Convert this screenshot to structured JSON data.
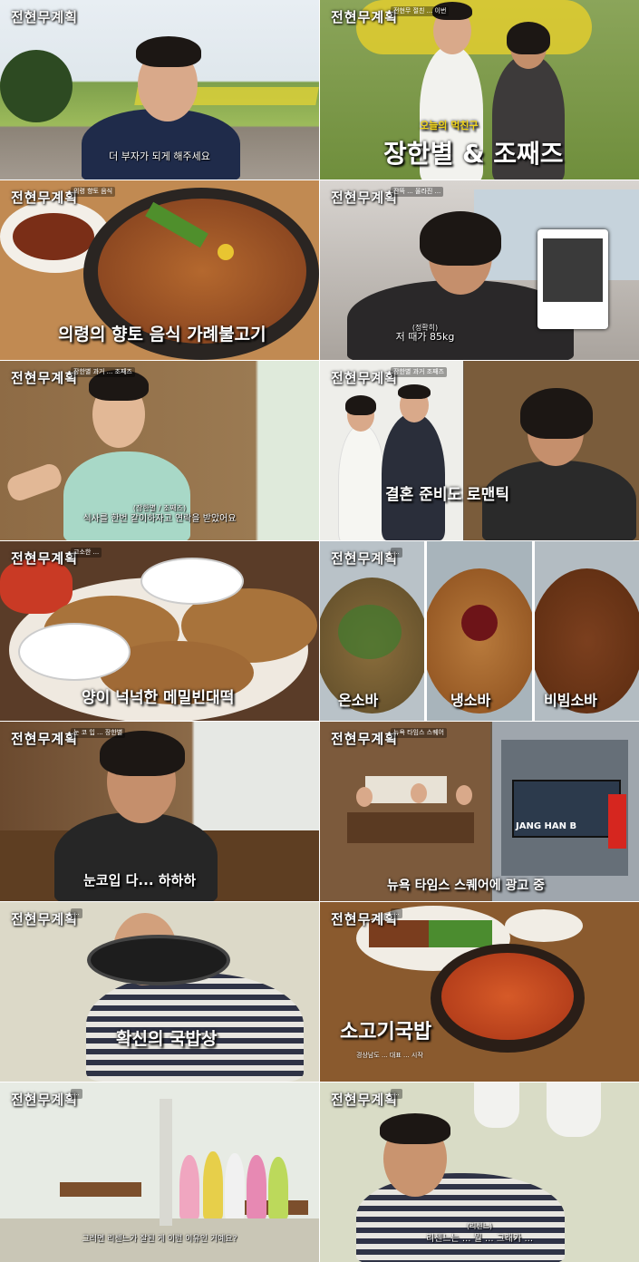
{
  "show_logo": "전현무계획",
  "panels": [
    {
      "tag": "",
      "subtitle": "더 부자가 되게 해주세요"
    },
    {
      "tag": "전현무 절친 ... 이번",
      "caption_small": "오늘의 먹친구",
      "caption_big": "장한별 & 조째즈"
    },
    {
      "tag": "의령 향토 음식",
      "caption_big": "의령의 향토 음식 가례불고기"
    },
    {
      "tag": "잔뜩 ... 올라진 ...",
      "subtitle_small": "(정확히)",
      "subtitle": "저 때가 85kg"
    },
    {
      "tag": "장한별 과거 ... 조째즈",
      "subtitle_small": "(장한별 / 조째즈)",
      "subtitle": "식사를 한번 같이하자고 연락을 받았어요"
    },
    {
      "tag": "장한별 과거 조째즈",
      "caption_big": "결혼 준비도 로맨틱"
    },
    {
      "tag": "고소한 ...",
      "caption_big": "양이 넉넉한 메밀빈대떡"
    },
    {
      "tag": "...",
      "labels": [
        "온소바",
        "냉소바",
        "비빔소바"
      ]
    },
    {
      "tag": "눈 코 입 ... 장한별",
      "subtitle": "눈코입 다... 하하하"
    },
    {
      "tag": "뉴욕 타임스 스퀘어",
      "caption_big": "뉴욕 타임스 스퀘어에 광고 중",
      "billboard_text": "JANG HAN B"
    },
    {
      "tag": "...",
      "caption_big": "확신의 국밥상"
    },
    {
      "tag": "...",
      "caption_big": "소고기국밥",
      "caption_small": "경상남도 ... 대표 ... 시작"
    },
    {
      "tag": "...",
      "subtitle": "그러면 리센느가 잘된 게 이런 이유인 거예요?"
    },
    {
      "tag": "...",
      "subtitle_small": "(리센느)",
      "subtitle": "리센느는 ... 뭘 ... 그래가 ..."
    }
  ],
  "colors": {
    "accent_yellow": "#f2d51c",
    "text_white": "#ffffff"
  }
}
